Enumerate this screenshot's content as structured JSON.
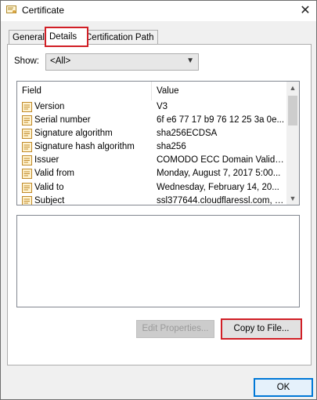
{
  "window": {
    "title": "Certificate"
  },
  "tabs": [
    {
      "label": "General"
    },
    {
      "label": "Details"
    },
    {
      "label": "Certification Path"
    }
  ],
  "show": {
    "label": "Show:",
    "selected": "<All>"
  },
  "list": {
    "columns": {
      "field": "Field",
      "value": "Value"
    },
    "rows": [
      {
        "field": "Version",
        "value": "V3"
      },
      {
        "field": "Serial number",
        "value": "6f e6 77 17 b9 76 12 25 3a 0e..."
      },
      {
        "field": "Signature algorithm",
        "value": "sha256ECDSA"
      },
      {
        "field": "Signature hash algorithm",
        "value": "sha256"
      },
      {
        "field": "Issuer",
        "value": "COMODO ECC Domain Validati..."
      },
      {
        "field": "Valid from",
        "value": "Monday, August 7, 2017 5:00..."
      },
      {
        "field": "Valid to",
        "value": "Wednesday, February 14, 20..."
      },
      {
        "field": "Subject",
        "value": "ssl377644.cloudflaressl.com, P..."
      }
    ]
  },
  "buttons": {
    "edit_properties": "Edit Properties...",
    "copy_to_file": "Copy to File...",
    "ok": "OK"
  },
  "colors": {
    "highlight": "#d11f26",
    "focus": "#0078d7"
  }
}
